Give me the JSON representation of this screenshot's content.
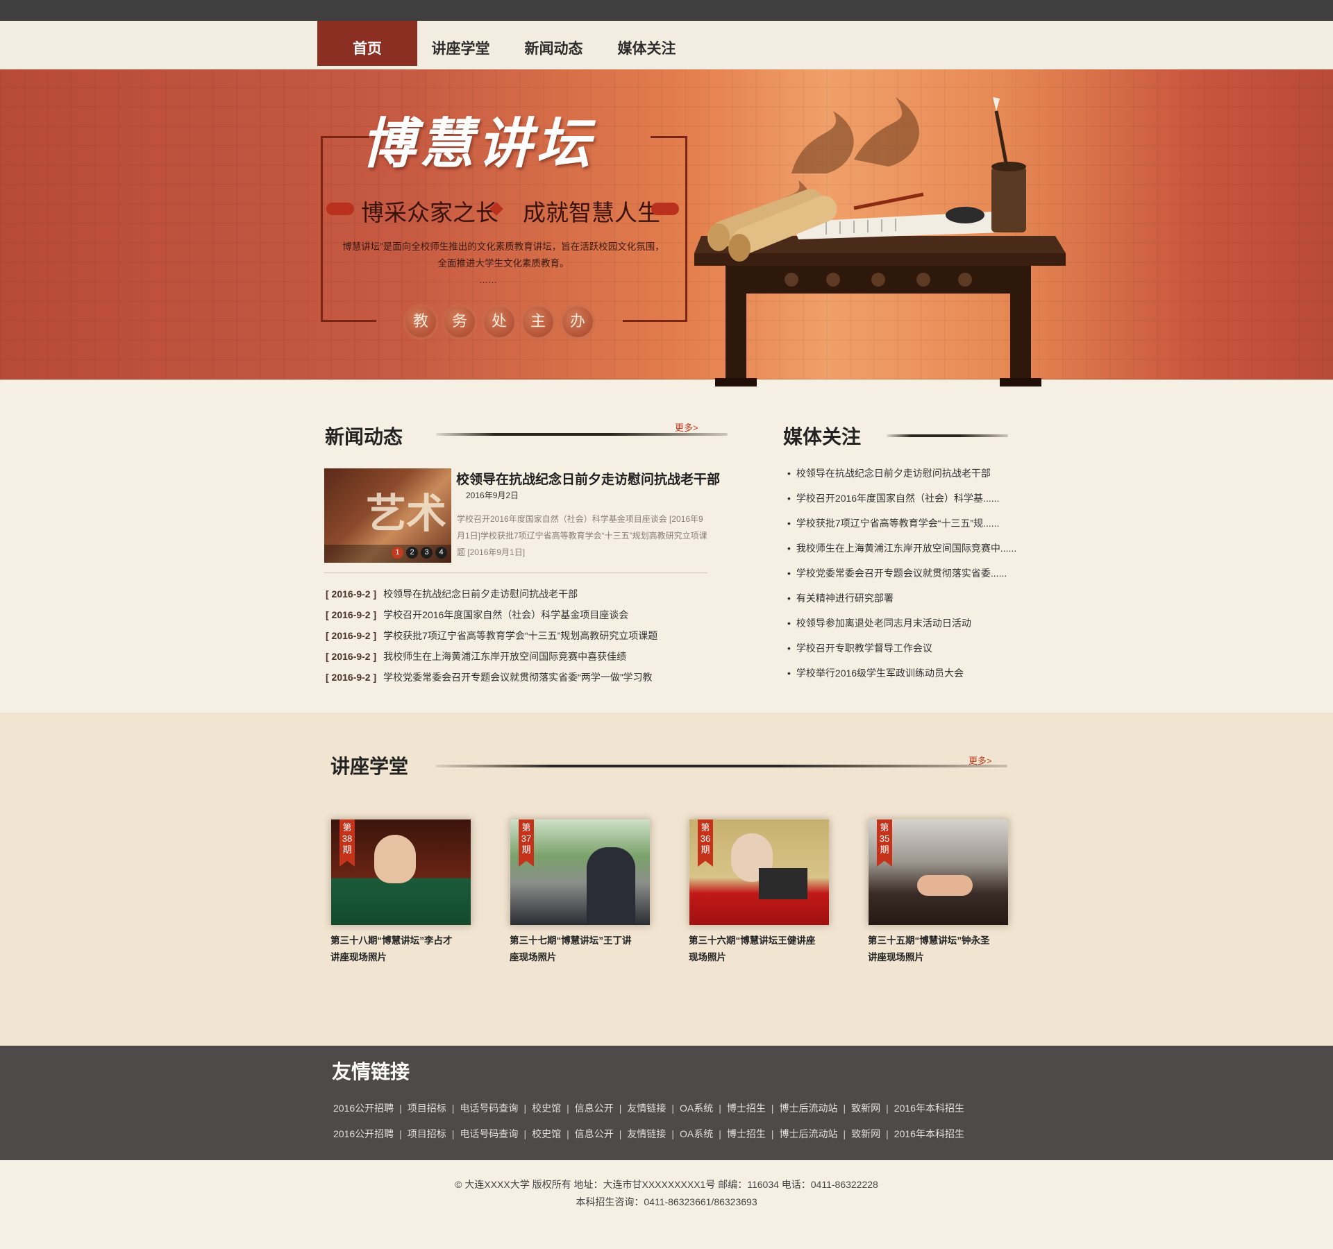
{
  "nav": {
    "items": [
      "首页",
      "讲座学堂",
      "新闻动态",
      "媒体关注"
    ],
    "active_index": 0
  },
  "hero": {
    "title": "博慧讲坛",
    "slogan_left": "博采众家之长",
    "slogan_right": "成就智慧人生",
    "description": "博慧讲坛”是面向全校师生推出的文化素质教育讲坛，旨在活跃校园文化氛围，全面推进大学生文化素质教育。",
    "ellipsis": "……",
    "seals": [
      "教",
      "务",
      "处",
      "主",
      "办"
    ]
  },
  "news": {
    "title": "新闻动态",
    "more": "更多>",
    "featured": {
      "headline": "校领导在抗战纪念日前夕走访慰问抗战老干部",
      "date": "2016年9月2日",
      "summary": "学校召开2016年度国家自然（社会）科学基金项目座谈会 [2016年9月1日]学校获批7项辽宁省高等教育学会“十三五”规划高教研究立项课题 [2016年9月1日]",
      "image_text": "艺术",
      "slides": [
        "1",
        "2",
        "3",
        "4"
      ],
      "active_slide": 0
    },
    "list": [
      {
        "date": "[ 2016-9-2 ]",
        "title": "校领导在抗战纪念日前夕走访慰问抗战老干部"
      },
      {
        "date": "[ 2016-9-2 ]",
        "title": "学校召开2016年度国家自然（社会）科学基金项目座谈会"
      },
      {
        "date": "[ 2016-9-2 ]",
        "title": "学校获批7项辽宁省高等教育学会“十三五”规划高教研究立项课题"
      },
      {
        "date": "[ 2016-9-2 ]",
        "title": "我校师生在上海黄浦江东岸开放空间国际竞赛中喜获佳绩"
      },
      {
        "date": "[ 2016-9-2 ]",
        "title": "学校党委常委会召开专题会议就贯彻落实省委“两学一做”学习教"
      }
    ]
  },
  "media": {
    "title": "媒体关注",
    "list": [
      "校领导在抗战纪念日前夕走访慰问抗战老干部",
      "学校召开2016年度国家自然（社会）科学基......",
      "学校获批7项辽宁省高等教育学会“十三五”规......",
      "我校师生在上海黄浦江东岸开放空间国际竞赛中......",
      "学校党委常委会召开专题会议就贯彻落实省委......",
      "有关精神进行研究部署",
      "校领导参加离退处老同志月末活动日活动",
      "学校召开专职教学督导工作会议",
      "学校举行2016级学生军政训练动员大会"
    ]
  },
  "lectures": {
    "title": "讲座学堂",
    "more": "更多>",
    "items": [
      {
        "ribbon": [
          "第",
          "38",
          "期"
        ],
        "caption_1": "第三十八期“博慧讲坛”李占才",
        "caption_2": "讲座现场照片"
      },
      {
        "ribbon": [
          "第",
          "37",
          "期"
        ],
        "caption_1": "第三十七期“博慧讲坛”王丁讲",
        "caption_2": "座现场照片"
      },
      {
        "ribbon": [
          "第",
          "36",
          "期"
        ],
        "caption_1": "第三十六期“博慧讲坛王健讲座",
        "caption_2": "现场照片"
      },
      {
        "ribbon": [
          "第",
          "35",
          "期"
        ],
        "caption_1": "第三十五期“博慧讲坛”钟永圣",
        "caption_2": "讲座现场照片"
      }
    ]
  },
  "links": {
    "title": "友情链接",
    "row1": [
      "2016公开招聘",
      "项目招标",
      "电话号码查询",
      "校史馆",
      "信息公开",
      "友情链接",
      "OA系统",
      "博士招生",
      "博士后流动站",
      "致新网",
      "2016年本科招生"
    ],
    "row2": [
      "2016公开招聘",
      "项目招标",
      "电话号码查询",
      "校史馆",
      "信息公开",
      "友情链接",
      "OA系统",
      "博士招生",
      "博士后流动站",
      "致新网",
      "2016年本科招生"
    ],
    "separator": "|"
  },
  "footer": {
    "line1": "© 大连XXXX大学 版权所有 地址：大连市甘XXXXXXXXX1号 邮编：116034 电话：0411-86322228",
    "line2": "本科招生咨询：0411-86323661/86323693"
  },
  "colors": {
    "accent": "#8b2f22",
    "hero_red": "#b84a38",
    "hero_orange": "#f0a06a",
    "link_red": "#c23a1e",
    "footer_band": "#4d4b49",
    "page_bg": "#f6efe3"
  }
}
